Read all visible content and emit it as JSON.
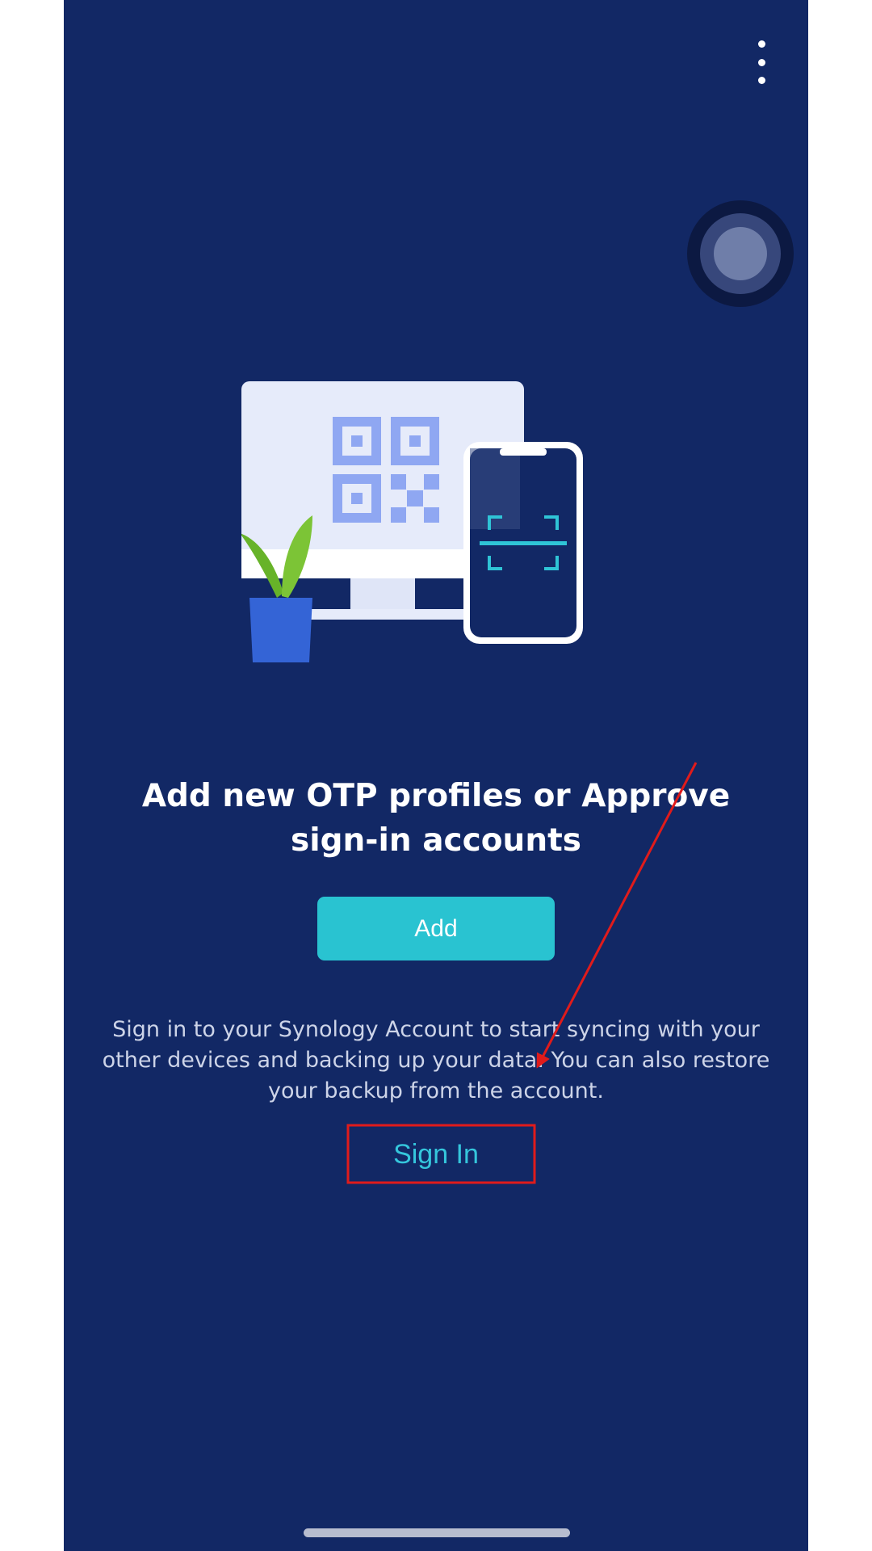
{
  "screen": {
    "headline": "Add new OTP profiles or Approve sign-in accounts",
    "add_label": "Add",
    "description": "Sign in to your Synology Account to start syncing with your other devices and backing up your data. You can also restore your backup from the account.",
    "signin_label": "Sign In"
  },
  "icons": {
    "menu": "more-vertical-icon",
    "assistive": "assistive-touch-icon"
  },
  "colors": {
    "background": "#122865",
    "accent": "#29c3d1",
    "link": "#35c6dc",
    "annotation": "#e01b1b"
  }
}
